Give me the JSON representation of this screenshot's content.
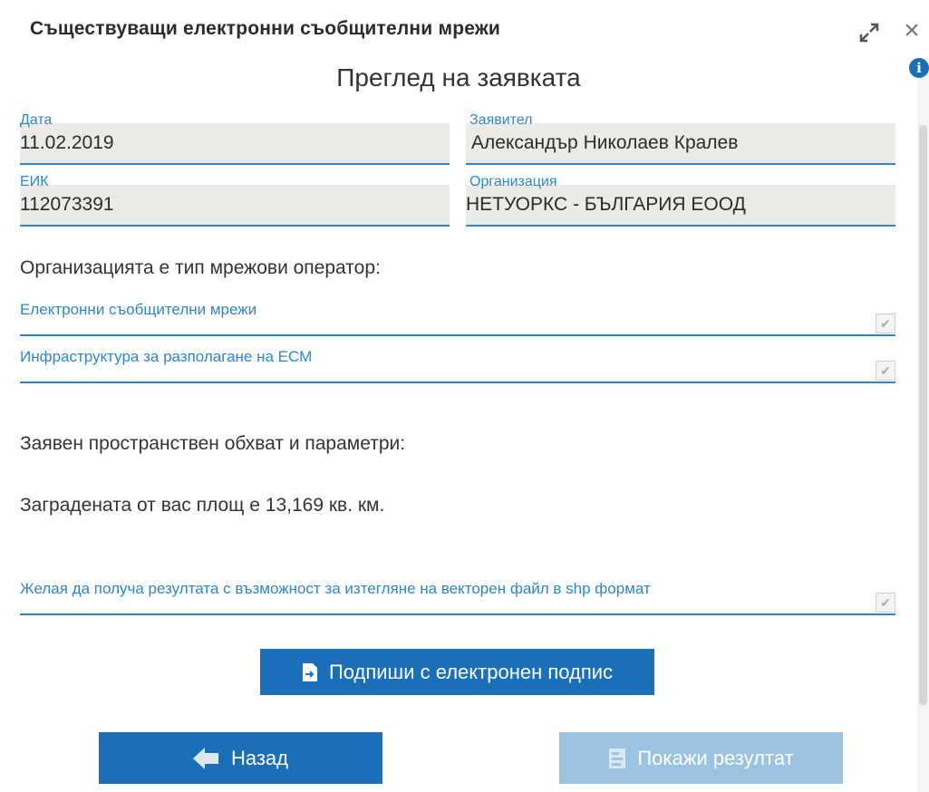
{
  "window": {
    "title": "Съществуващи електронни съобщителни мрежи"
  },
  "page": {
    "heading": "Преглед на заявката"
  },
  "fields": [
    {
      "label": "Дата",
      "value": "11.02.2019"
    },
    {
      "label": "Заявител",
      "value": "Александър Николаев Кралев"
    },
    {
      "label": "ЕИК",
      "value": "112073391"
    },
    {
      "label": "Организация",
      "value": "НЕТУОРКС - БЪЛГАРИЯ ЕООД"
    }
  ],
  "operator": {
    "title": "Организацията е тип мрежови оператор:",
    "options": [
      {
        "label": "Електронни съобщителни мрежи",
        "checked": true
      },
      {
        "label": "Инфраструктура за разполагане на ЕСМ",
        "checked": true
      }
    ]
  },
  "scope": {
    "title": "Заявен пространствен обхват и параметри:",
    "area_text": "Заградената от вас площ е 13,169 кв. км."
  },
  "vector_option": {
    "label": "Желая да получа резултата с възможност за изтегляне на векторен файл в shp формат",
    "checked": true
  },
  "buttons": {
    "sign": "Подпиши с електронен подпис",
    "back": "Назад",
    "result": "Покажи резултат"
  },
  "icons": {
    "expand": "expand-icon",
    "close": "close-icon",
    "info": "info-icon"
  },
  "colors": {
    "accent": "#1a6fb8",
    "label_blue": "#2e86c8",
    "field_bg": "#eceae6",
    "disabled_button": "#9bc2e0"
  }
}
